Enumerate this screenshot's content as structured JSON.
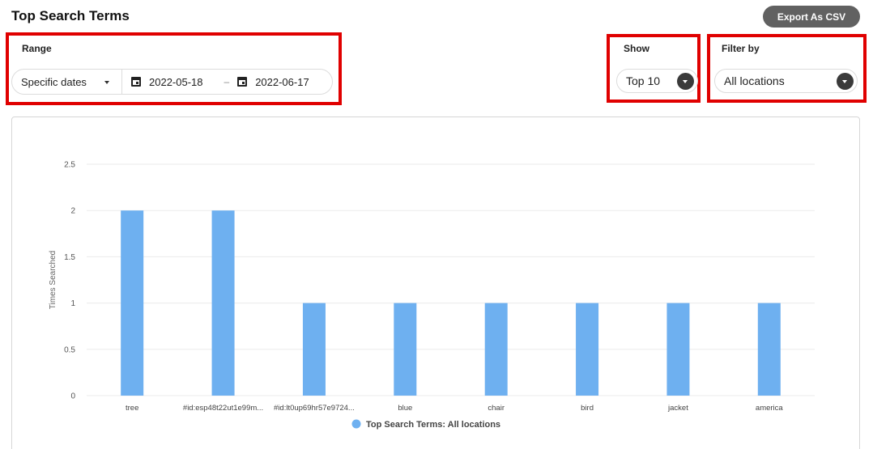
{
  "header": {
    "title": "Top Search Terms",
    "export_label": "Export As CSV"
  },
  "range": {
    "label": "Range",
    "type": "Specific dates",
    "start": "2022-05-18",
    "separator": "–",
    "end": "2022-06-17"
  },
  "show": {
    "label": "Show",
    "value": "Top 10"
  },
  "filter": {
    "label": "Filter by",
    "value": "All locations"
  },
  "colors": {
    "bar": "#6eb0f0",
    "highlight": "#e00000",
    "export_button": "#616161"
  },
  "chart_data": {
    "type": "bar",
    "categories": [
      "tree",
      "#id:esp48t22ut1e99m...",
      "#id:lt0up69hr57e9724...",
      "blue",
      "chair",
      "bird",
      "jacket",
      "america"
    ],
    "series": [
      {
        "name": "Top Search Terms: All locations",
        "values": [
          2,
          2,
          1,
          1,
          1,
          1,
          1,
          1
        ]
      }
    ],
    "ylabel": "Times Searched",
    "xlabel": "",
    "ylim": [
      0,
      2.5
    ],
    "yticks": [
      "0",
      "0.5",
      "1",
      "1.5",
      "2",
      "2.5"
    ],
    "grid": true,
    "legend_position": "bottom"
  }
}
